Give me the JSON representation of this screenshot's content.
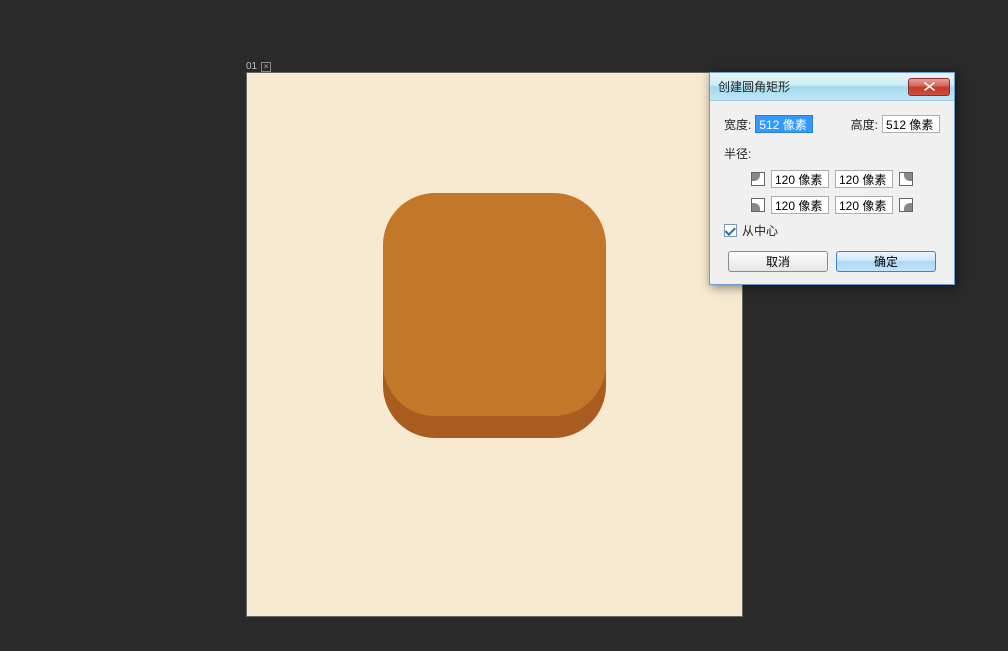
{
  "canvas": {
    "tab_label": "01",
    "bg_color": "#f7ead1",
    "icon_color_top": "#c27828",
    "icon_color_side": "#a85d1f"
  },
  "dialog": {
    "title": "创建圆角矩形",
    "width_label": "宽度:",
    "width_value": "512 像素",
    "height_label": "高度:",
    "height_value": "512 像素",
    "radius_label": "半径:",
    "radii": {
      "tl": "120 像素",
      "tr": "120 像素",
      "bl": "120 像素",
      "br": "120 像素"
    },
    "from_center_label": "从中心",
    "from_center_checked": true,
    "cancel_label": "取消",
    "ok_label": "确定"
  }
}
